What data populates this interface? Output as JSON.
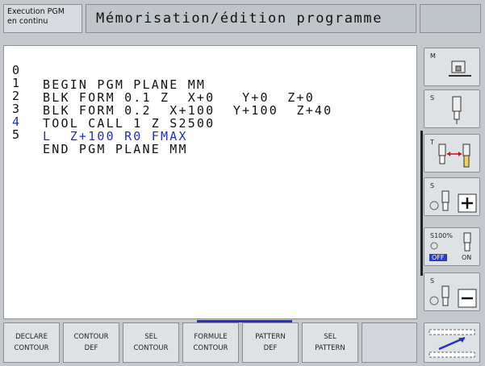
{
  "header": {
    "mode_line1": "Execution PGM",
    "mode_line2": "en continu",
    "title": "Mémorisation/édition programme"
  },
  "program": {
    "lines": [
      {
        "num": "0",
        "code": "BEGIN PGM PLANE MM"
      },
      {
        "num": "1",
        "code": "BLK FORM 0.1 Z  X+0   Y+0  Z+0"
      },
      {
        "num": "2",
        "code": "BLK FORM 0.2  X+100  Y+100  Z+40"
      },
      {
        "num": "3",
        "code": "TOOL CALL 1 Z S2500"
      },
      {
        "num": "4",
        "code": "L  Z+100 R0 FMAX"
      },
      {
        "num": "5",
        "code": "END PGM PLANE MM"
      }
    ],
    "active_line": 4
  },
  "right_softkeys": [
    {
      "label": "M",
      "icon": "machine-icon"
    },
    {
      "label": "S",
      "icon": "spindle-icon"
    },
    {
      "label": "T",
      "icon": "tool-length-icon"
    },
    {
      "label": "S",
      "icon": "spindle-plus-icon"
    },
    {
      "label": "S100%",
      "icon": "spindle-override-icon",
      "off": "OFF",
      "on": "ON"
    },
    {
      "label": "S",
      "icon": "spindle-minus-icon"
    }
  ],
  "bottom_softkeys": [
    {
      "line1": "DECLARE",
      "line2": "CONTOUR"
    },
    {
      "line1": "CONTOUR",
      "line2": "DEF"
    },
    {
      "line1": "SEL",
      "line2": "CONTOUR"
    },
    {
      "line1": "FORMULE",
      "line2": "CONTOUR"
    },
    {
      "line1": "PATTERN",
      "line2": "DEF"
    },
    {
      "line1": "SEL",
      "line2": "PATTERN"
    },
    {
      "line1": "",
      "line2": ""
    }
  ],
  "colors": {
    "active_text": "#1f2ec8",
    "accent": "#2430c8",
    "off_badge": "#2a3bd0"
  }
}
